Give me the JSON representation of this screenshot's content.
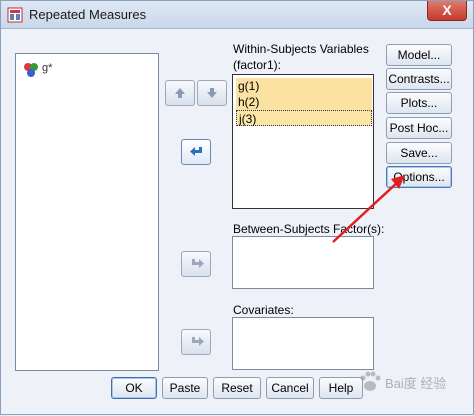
{
  "window": {
    "title": "Repeated Measures",
    "close_glyph": "X"
  },
  "source_list": {
    "items": [
      {
        "label": "g*",
        "icon": "variable-scale-icon"
      }
    ]
  },
  "within": {
    "label": "Within-Subjects Variables",
    "factor": "(factor1):",
    "rows": [
      "g(1)",
      "h(2)",
      "j(3)"
    ]
  },
  "between": {
    "label": "Between-Subjects Factor(s):"
  },
  "covariates": {
    "label": "Covariates:"
  },
  "side_buttons": {
    "model": "Model...",
    "contrasts": "Contrasts...",
    "plots": "Plots...",
    "post_hoc": "Post Hoc...",
    "save": "Save...",
    "options": "Options..."
  },
  "bottom_buttons": {
    "ok": "OK",
    "paste": "Paste",
    "reset": "Reset",
    "cancel": "Cancel",
    "help": "Help"
  },
  "watermark": {
    "text": "Bai度 经验"
  },
  "colors": {
    "highlight": "#fbe2a3",
    "annotation": "#e02020",
    "arrow_blue": "#2f6fc0"
  }
}
